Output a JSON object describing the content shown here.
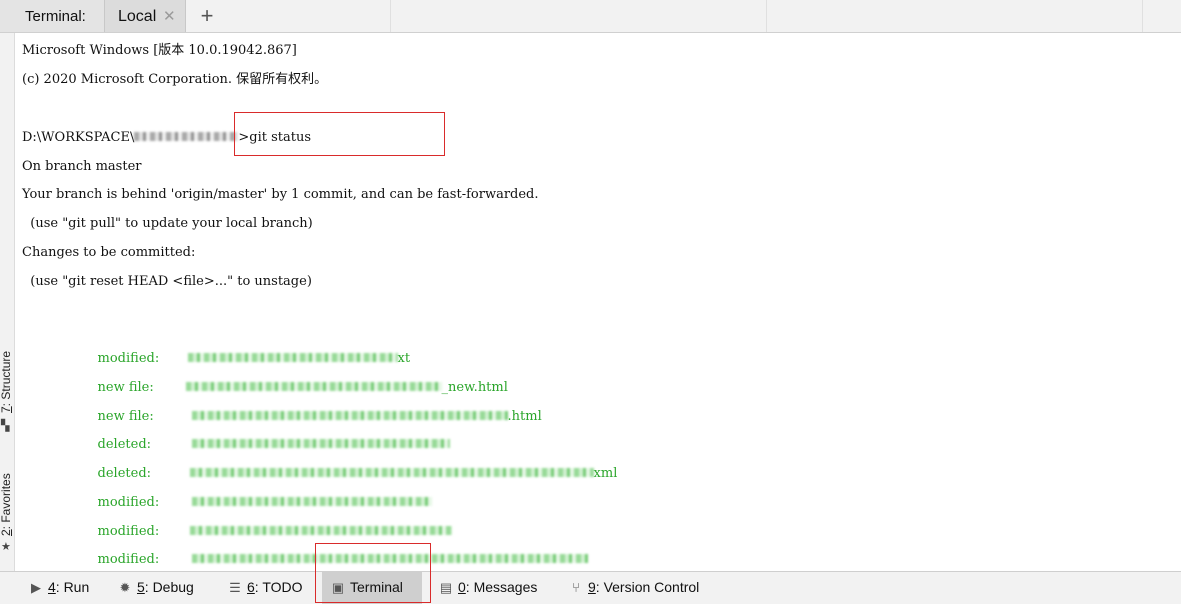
{
  "tabs": {
    "title": "Terminal:",
    "local_label": "Local",
    "close_glyph": "✕",
    "add_glyph": "+"
  },
  "side_tools": {
    "structure": {
      "key": "7",
      "label": ": Structure",
      "icon": "structure-icon"
    },
    "favorites": {
      "key": "2",
      "label": ": Favorites",
      "icon": "star-icon"
    }
  },
  "terminal": {
    "line1": "Microsoft Windows [版本 10.0.19042.867]",
    "line2": "(c) 2020 Microsoft Corporation. 保留所有权利。",
    "prompt_prefix": "D:\\WORKSPACE\\",
    "prompt_suffix": ">",
    "command": "git status",
    "out1": "On branch master",
    "out2": "Your branch is behind 'origin/master' by 1 commit, and can be fast-forwarded.",
    "out3": "  (use \"git pull\" to update your local branch)",
    "out4": "Changes to be committed:",
    "out5": "  (use \"git reset HEAD <file>...\" to unstage)",
    "changes": [
      {
        "status": "modified:",
        "tail": "xt"
      },
      {
        "status": "new file:",
        "tail": "_new.html"
      },
      {
        "status": "new file:",
        "tail": ".html"
      },
      {
        "status": "deleted:",
        "tail": ""
      },
      {
        "status": "deleted:",
        "tail": "xml"
      },
      {
        "status": "modified:",
        "tail": ""
      },
      {
        "status": "modified:",
        "tail": ""
      },
      {
        "status": "modified:",
        "tail": ""
      }
    ]
  },
  "bottom": {
    "run": {
      "key": "4",
      "label": ": Run",
      "icon": "play-icon"
    },
    "debug": {
      "key": "5",
      "label": ": Debug",
      "icon": "bug-icon"
    },
    "todo": {
      "key": "6",
      "label": ": TODO",
      "icon": "list-icon"
    },
    "terminal": {
      "label": "Terminal",
      "icon": "terminal-icon"
    },
    "messages": {
      "key": "0",
      "label": ": Messages",
      "icon": "message-icon"
    },
    "vcs": {
      "key": "9",
      "label": ": Version Control",
      "icon": "branch-icon"
    }
  },
  "colors": {
    "highlight": "#d92b2b",
    "git_green": "#2aa52a"
  }
}
